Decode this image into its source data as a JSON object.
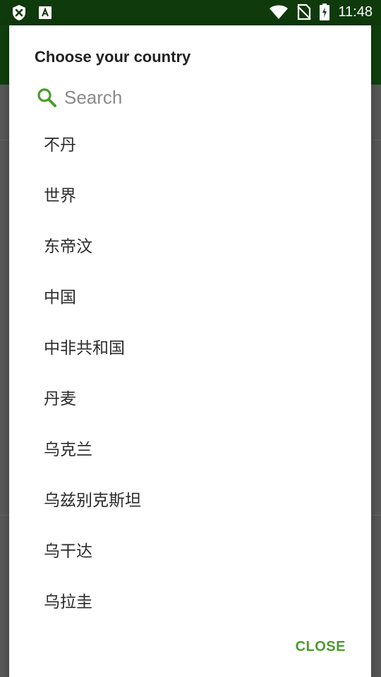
{
  "status_bar": {
    "time": "11:48",
    "icons": [
      "notification-close-icon",
      "a-letter-icon",
      "wifi-icon",
      "no-sim-icon",
      "battery-charging-icon"
    ]
  },
  "dialog": {
    "title": "Choose your country",
    "search": {
      "placeholder": "Search",
      "value": ""
    },
    "countries": [
      "不丹",
      "世界",
      "东帝汶",
      "中国",
      "中非共和国",
      "丹麦",
      "乌克兰",
      "乌兹别克斯坦",
      "乌干达",
      "乌拉圭"
    ],
    "close_label": "CLOSE"
  },
  "colors": {
    "accent": "#4a9b2a",
    "status_bar": "#0f3a0c",
    "dim_background": "#585858"
  }
}
